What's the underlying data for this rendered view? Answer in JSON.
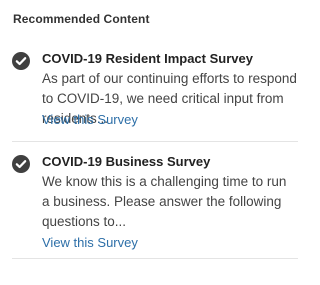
{
  "section": {
    "title": "Recommended Content"
  },
  "items": [
    {
      "icon": "check-circle-icon",
      "title": "COVID-19 Resident Impact Survey",
      "description": "As part of our continuing efforts to respond to COVID-19, we need critical input from residents...",
      "link": "View this Survey"
    },
    {
      "icon": "check-circle-icon",
      "title": "COVID-19 Business Survey",
      "description": "We know this is a challenging time to run a business.  Please answer the following questions to...",
      "link": "View this Survey"
    }
  ],
  "colors": {
    "icon": "#404040",
    "link": "#2d6fa8",
    "divider": "#e4e4e4"
  }
}
